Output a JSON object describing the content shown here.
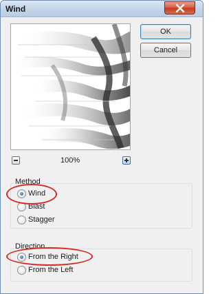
{
  "dialog": {
    "title": "Wind",
    "ok_label": "OK",
    "cancel_label": "Cancel",
    "zoom_level": "100%"
  },
  "method": {
    "label": "Method",
    "options": [
      {
        "label": "Wind",
        "selected": true
      },
      {
        "label": "Blast",
        "selected": false
      },
      {
        "label": "Stagger",
        "selected": false
      }
    ]
  },
  "direction": {
    "label": "Direction",
    "options": [
      {
        "label": "From the Right",
        "selected": true
      },
      {
        "label": "From the Left",
        "selected": false
      }
    ]
  },
  "colors": {
    "annotation": "#d22c26",
    "radio_selected": "#1c5a96"
  },
  "icons": {
    "close": "close-icon",
    "zoom_out": "minus-icon",
    "zoom_in": "plus-icon"
  }
}
